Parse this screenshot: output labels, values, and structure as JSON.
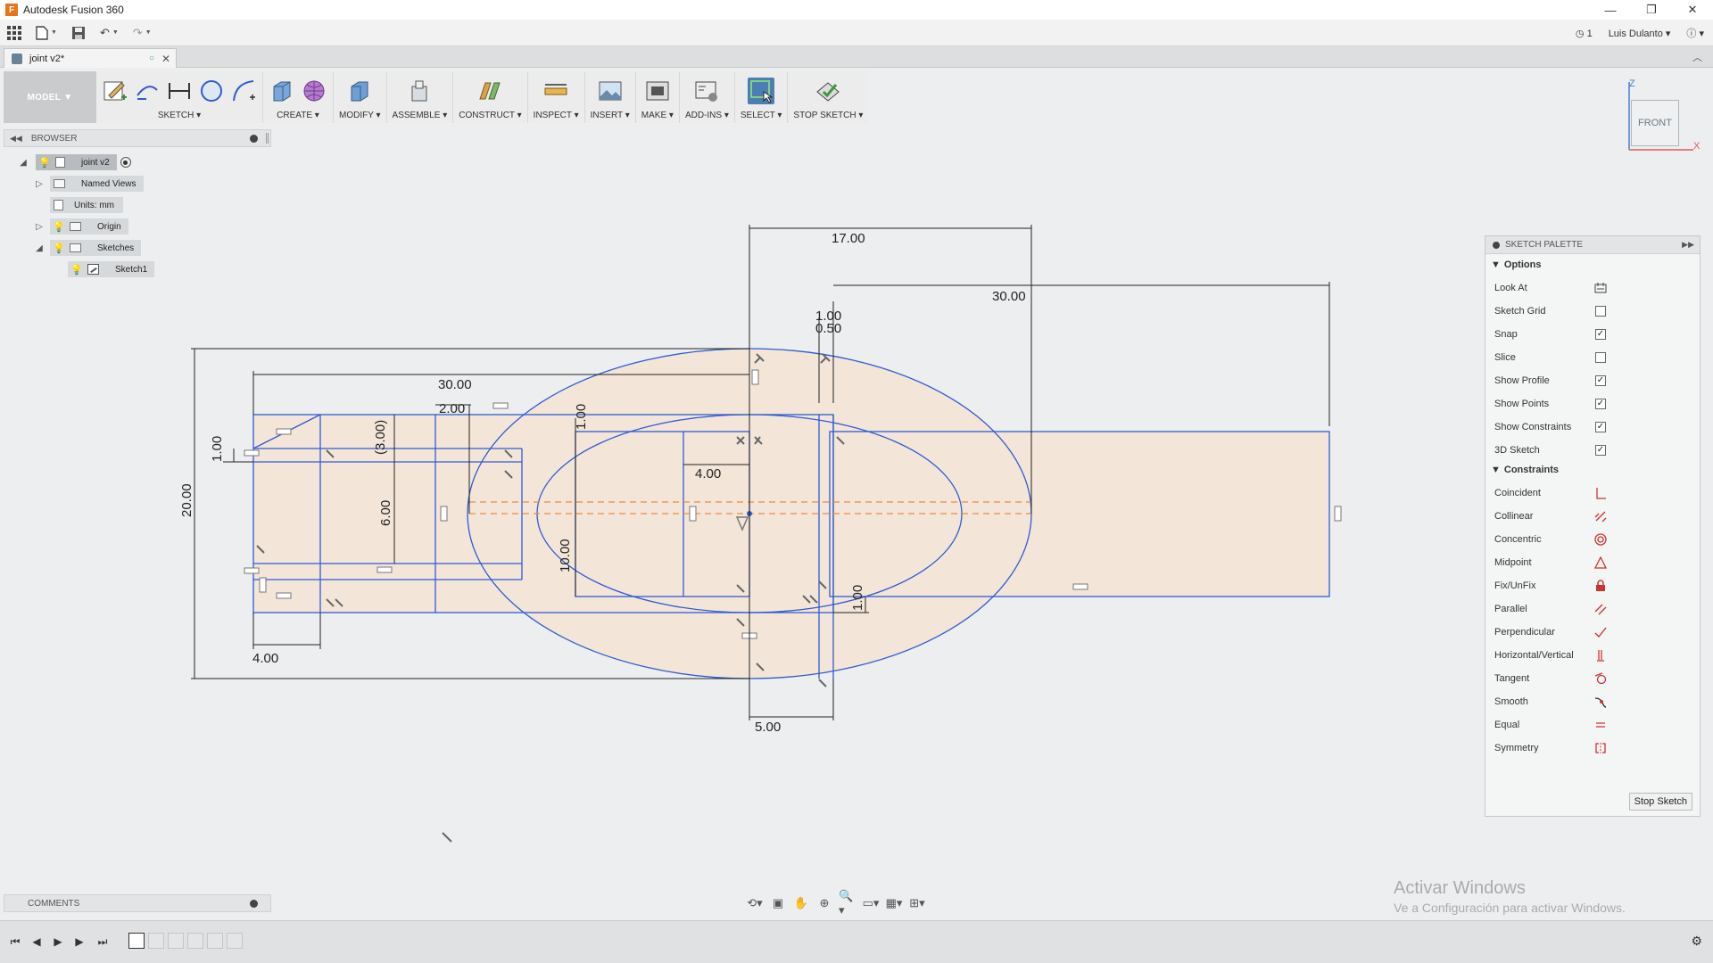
{
  "titlebar": {
    "title": "Autodesk Fusion 360",
    "minimize": "—",
    "restore": "❐",
    "close": "✕"
  },
  "quickaccess": {
    "jobs": "1",
    "user": "Luis Dulanto",
    "help": "?"
  },
  "document": {
    "tab_title": "joint v2*"
  },
  "toolbar": {
    "workspace": "MODEL",
    "groups": [
      {
        "label": "SKETCH"
      },
      {
        "label": "CREATE"
      },
      {
        "label": "MODIFY"
      },
      {
        "label": "ASSEMBLE"
      },
      {
        "label": "CONSTRUCT"
      },
      {
        "label": "INSPECT"
      },
      {
        "label": "INSERT"
      },
      {
        "label": "MAKE"
      },
      {
        "label": "ADD-INS"
      },
      {
        "label": "SELECT"
      },
      {
        "label": "STOP SKETCH"
      }
    ]
  },
  "browser": {
    "title": "BROWSER",
    "items": [
      {
        "label": "joint v2"
      },
      {
        "label": "Named Views"
      },
      {
        "label": "Units: mm"
      },
      {
        "label": "Origin"
      },
      {
        "label": "Sketches"
      },
      {
        "label": "Sketch1"
      }
    ]
  },
  "viewcube": {
    "face": "FRONT",
    "axis_z": "Z",
    "axis_x": "X"
  },
  "palette": {
    "title": "SKETCH PALETTE",
    "options_title": "Options",
    "options": [
      {
        "label": "Look At",
        "type": "icon"
      },
      {
        "label": "Sketch Grid",
        "checked": false
      },
      {
        "label": "Snap",
        "checked": true
      },
      {
        "label": "Slice",
        "checked": false
      },
      {
        "label": "Show Profile",
        "checked": true
      },
      {
        "label": "Show Points",
        "checked": true
      },
      {
        "label": "Show Constraints",
        "checked": true
      },
      {
        "label": "3D Sketch",
        "checked": true
      }
    ],
    "constraints_title": "Constraints",
    "constraints": [
      {
        "label": "Coincident",
        "icon": "coincident-icon"
      },
      {
        "label": "Collinear",
        "icon": "collinear-icon"
      },
      {
        "label": "Concentric",
        "icon": "concentric-icon"
      },
      {
        "label": "Midpoint",
        "icon": "midpoint-icon"
      },
      {
        "label": "Fix/UnFix",
        "icon": "lock-icon"
      },
      {
        "label": "Parallel",
        "icon": "parallel-icon"
      },
      {
        "label": "Perpendicular",
        "icon": "perpendicular-icon"
      },
      {
        "label": "Horizontal/Vertical",
        "icon": "horizontal-vertical-icon"
      },
      {
        "label": "Tangent",
        "icon": "tangent-icon"
      },
      {
        "label": "Smooth",
        "icon": "smooth-icon"
      },
      {
        "label": "Equal",
        "icon": "equal-icon"
      },
      {
        "label": "Symmetry",
        "icon": "symmetry-icon"
      }
    ],
    "stop_button": "Stop Sketch"
  },
  "comments": {
    "title": "COMMENTS"
  },
  "watermark": {
    "line1": "Activar Windows",
    "line2": "Ve a Configuración para activar Windows."
  },
  "sketch": {
    "dims": {
      "d17": "17.00",
      "d30_top": "30.00",
      "d30_left": "30.00",
      "d1_00_top": "1.00",
      "d0_50": "0.50",
      "d2_00": "2.00",
      "d1_00_mid": "1.00",
      "d3_00_ref": "(3.00)",
      "d1_00_left": "1.00",
      "d4_00_inner": "4.00",
      "d6_00": "6.00",
      "d10_00": "10.00",
      "d20_00": "20.00",
      "d1_00_right": "1.00",
      "d4_00_bottom": "4.00",
      "d5_00": "5.00"
    }
  },
  "colors": {
    "accent": "#4c7eb3",
    "profile_fill": "#f3e6d8",
    "sketch_line": "#2f5bd3",
    "centerline": "#e8894a"
  }
}
